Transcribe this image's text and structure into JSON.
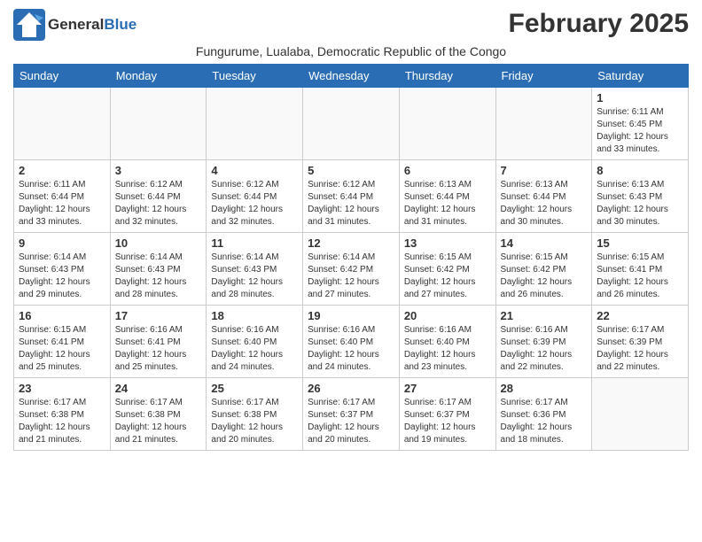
{
  "header": {
    "logo_general": "General",
    "logo_blue": "Blue",
    "month": "February 2025",
    "location": "Fungurume, Lualaba, Democratic Republic of the Congo"
  },
  "weekdays": [
    "Sunday",
    "Monday",
    "Tuesday",
    "Wednesday",
    "Thursday",
    "Friday",
    "Saturday"
  ],
  "weeks": [
    [
      {
        "day": "",
        "info": ""
      },
      {
        "day": "",
        "info": ""
      },
      {
        "day": "",
        "info": ""
      },
      {
        "day": "",
        "info": ""
      },
      {
        "day": "",
        "info": ""
      },
      {
        "day": "",
        "info": ""
      },
      {
        "day": "1",
        "info": "Sunrise: 6:11 AM\nSunset: 6:45 PM\nDaylight: 12 hours\nand 33 minutes."
      }
    ],
    [
      {
        "day": "2",
        "info": "Sunrise: 6:11 AM\nSunset: 6:44 PM\nDaylight: 12 hours\nand 33 minutes."
      },
      {
        "day": "3",
        "info": "Sunrise: 6:12 AM\nSunset: 6:44 PM\nDaylight: 12 hours\nand 32 minutes."
      },
      {
        "day": "4",
        "info": "Sunrise: 6:12 AM\nSunset: 6:44 PM\nDaylight: 12 hours\nand 32 minutes."
      },
      {
        "day": "5",
        "info": "Sunrise: 6:12 AM\nSunset: 6:44 PM\nDaylight: 12 hours\nand 31 minutes."
      },
      {
        "day": "6",
        "info": "Sunrise: 6:13 AM\nSunset: 6:44 PM\nDaylight: 12 hours\nand 31 minutes."
      },
      {
        "day": "7",
        "info": "Sunrise: 6:13 AM\nSunset: 6:44 PM\nDaylight: 12 hours\nand 30 minutes."
      },
      {
        "day": "8",
        "info": "Sunrise: 6:13 AM\nSunset: 6:43 PM\nDaylight: 12 hours\nand 30 minutes."
      }
    ],
    [
      {
        "day": "9",
        "info": "Sunrise: 6:14 AM\nSunset: 6:43 PM\nDaylight: 12 hours\nand 29 minutes."
      },
      {
        "day": "10",
        "info": "Sunrise: 6:14 AM\nSunset: 6:43 PM\nDaylight: 12 hours\nand 28 minutes."
      },
      {
        "day": "11",
        "info": "Sunrise: 6:14 AM\nSunset: 6:43 PM\nDaylight: 12 hours\nand 28 minutes."
      },
      {
        "day": "12",
        "info": "Sunrise: 6:14 AM\nSunset: 6:42 PM\nDaylight: 12 hours\nand 27 minutes."
      },
      {
        "day": "13",
        "info": "Sunrise: 6:15 AM\nSunset: 6:42 PM\nDaylight: 12 hours\nand 27 minutes."
      },
      {
        "day": "14",
        "info": "Sunrise: 6:15 AM\nSunset: 6:42 PM\nDaylight: 12 hours\nand 26 minutes."
      },
      {
        "day": "15",
        "info": "Sunrise: 6:15 AM\nSunset: 6:41 PM\nDaylight: 12 hours\nand 26 minutes."
      }
    ],
    [
      {
        "day": "16",
        "info": "Sunrise: 6:15 AM\nSunset: 6:41 PM\nDaylight: 12 hours\nand 25 minutes."
      },
      {
        "day": "17",
        "info": "Sunrise: 6:16 AM\nSunset: 6:41 PM\nDaylight: 12 hours\nand 25 minutes."
      },
      {
        "day": "18",
        "info": "Sunrise: 6:16 AM\nSunset: 6:40 PM\nDaylight: 12 hours\nand 24 minutes."
      },
      {
        "day": "19",
        "info": "Sunrise: 6:16 AM\nSunset: 6:40 PM\nDaylight: 12 hours\nand 24 minutes."
      },
      {
        "day": "20",
        "info": "Sunrise: 6:16 AM\nSunset: 6:40 PM\nDaylight: 12 hours\nand 23 minutes."
      },
      {
        "day": "21",
        "info": "Sunrise: 6:16 AM\nSunset: 6:39 PM\nDaylight: 12 hours\nand 22 minutes."
      },
      {
        "day": "22",
        "info": "Sunrise: 6:17 AM\nSunset: 6:39 PM\nDaylight: 12 hours\nand 22 minutes."
      }
    ],
    [
      {
        "day": "23",
        "info": "Sunrise: 6:17 AM\nSunset: 6:38 PM\nDaylight: 12 hours\nand 21 minutes."
      },
      {
        "day": "24",
        "info": "Sunrise: 6:17 AM\nSunset: 6:38 PM\nDaylight: 12 hours\nand 21 minutes."
      },
      {
        "day": "25",
        "info": "Sunrise: 6:17 AM\nSunset: 6:38 PM\nDaylight: 12 hours\nand 20 minutes."
      },
      {
        "day": "26",
        "info": "Sunrise: 6:17 AM\nSunset: 6:37 PM\nDaylight: 12 hours\nand 20 minutes."
      },
      {
        "day": "27",
        "info": "Sunrise: 6:17 AM\nSunset: 6:37 PM\nDaylight: 12 hours\nand 19 minutes."
      },
      {
        "day": "28",
        "info": "Sunrise: 6:17 AM\nSunset: 6:36 PM\nDaylight: 12 hours\nand 18 minutes."
      },
      {
        "day": "",
        "info": ""
      }
    ]
  ]
}
